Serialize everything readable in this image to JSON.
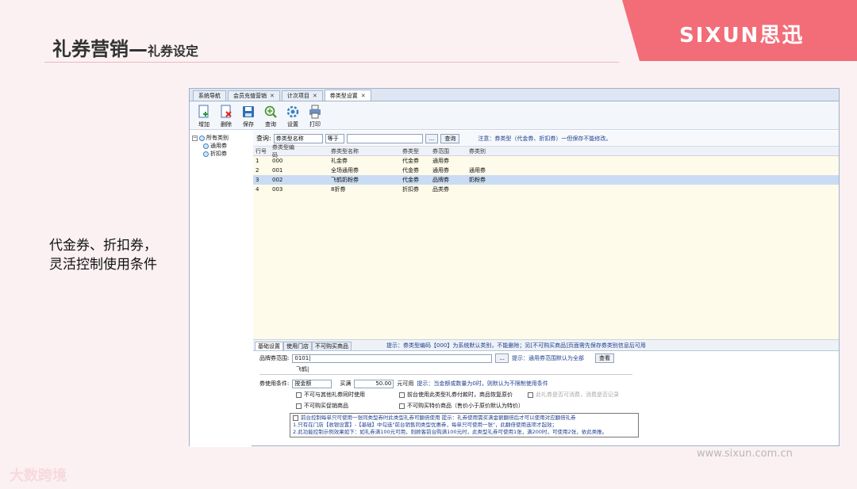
{
  "slide": {
    "title_main": "礼券营销—",
    "title_sub": "礼券设定",
    "brand": "SIXUN思迅",
    "caption_line1": "代金券、折扣券，",
    "caption_line2": "灵活控制使用条件",
    "url": "www.sixun.com.cn",
    "watermark": "大数跨境"
  },
  "app": {
    "tabs": [
      {
        "label": "系统导航"
      },
      {
        "label": "会员充值营销"
      },
      {
        "label": "计次项目"
      },
      {
        "label": "券类型设置"
      }
    ],
    "toolbar": {
      "add": "增加",
      "delete": "删除",
      "save": "保存",
      "query": "查询",
      "settings": "设置",
      "print": "打印"
    },
    "tree": {
      "root": "所有类别",
      "items": [
        "通用券",
        "折扣券"
      ]
    },
    "query": {
      "label": "查询:",
      "field": "券类型名称",
      "operator": "等于",
      "value": "",
      "ellipsis": "...",
      "button": "查询",
      "note": "注意：券类型（代金券、折扣券）一但保存不能修改。"
    },
    "grid": {
      "headers": [
        "行号",
        "券类型编码",
        "券类型名称",
        "券类型",
        "券范围",
        "券类别"
      ],
      "rows": [
        [
          "1",
          "000",
          "礼金券",
          "代金券",
          "通用券",
          ""
        ],
        [
          "2",
          "001",
          "全场通用券",
          "代金券",
          "通用券",
          "通用券"
        ],
        [
          "3",
          "002",
          "飞鹤奶粉券",
          "代金券",
          "品牌券",
          "奶粉券"
        ],
        [
          "4",
          "003",
          "8折券",
          "折扣券",
          "品类券",
          ""
        ]
      ]
    },
    "bottom": {
      "tabs": [
        "基础设置",
        "使用门店",
        "不可购买商品"
      ],
      "hint": "提示：券类型编码【000】为系统默认类别，不能删除；另[不可购买商品]页面需先保存券类别信息后可用"
    },
    "form": {
      "brand_scope_label": "品牌券范围:",
      "brand_scope_value": "0101|",
      "brand_scope_hint": "提示：通用券范围默认为全部",
      "view_button": "查看",
      "brand_name": "飞鹤|",
      "condition_label": "券使用条件:",
      "condition_value": "按金额",
      "buy_label": "买满",
      "buy_value": "50.00",
      "usable_label": "元可用",
      "condition_hint": "提示：当金额或数量为0时，则默认为不限制使用条件",
      "checks": [
        "不可与其他礼券同时使用",
        "前台使用此类型礼券付款时，商品恢复原价",
        "此礼券是否可消费，消费是否记录",
        "不可购买促销商品",
        "不可购买特价商品（售价小于原价默认为特价）"
      ],
      "note_line1": "前台控制每单只可使用一张同类型券时此类型礼券可翻倍使用    提示：礼券使用需买满金额翻倍后才可以使用对应翻倍礼券",
      "note_line2": "1.只有在门店【收银设置】-【基础】中勾选\"前台销售同类型优惠券，每单只可使用一张\"，此翻倍使用选项才起效；",
      "note_line3": "2.此功能控制示例效果如下：如礼券满100元可用，则顾客前台购满100元时，此类型礼券可使用1张，满200时，可使用2张，依此类推。"
    }
  }
}
